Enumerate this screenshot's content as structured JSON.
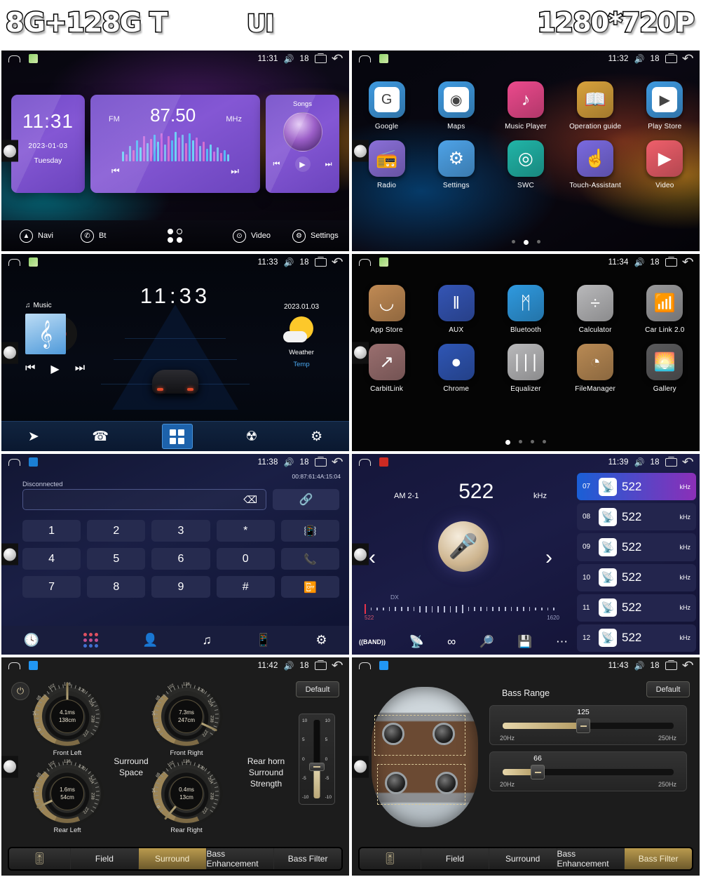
{
  "banner": {
    "left": "8G+128G T",
    "center": "UI",
    "right": "1280*720P"
  },
  "statusbar_common": {
    "volume": "18",
    "home_icon": "home-icon",
    "recents_icon": "recents-icon",
    "back_icon": "back-icon"
  },
  "panels": {
    "home_widgets": {
      "time": "11:31",
      "clock_widget": {
        "time": "11:31",
        "date": "2023-01-03",
        "weekday": "Tuesday"
      },
      "radio_widget": {
        "band": "FM",
        "frequency": "87.50",
        "unit": "MHz",
        "prev": "prev-icon",
        "next": "next-icon"
      },
      "song_widget": {
        "title": "Songs",
        "prev": "prev-icon",
        "play": "play-icon",
        "next": "next-icon"
      },
      "dock": [
        {
          "label": "Navi",
          "icon": "navi-icon"
        },
        {
          "label": "Bt",
          "icon": "bluetooth-phone-icon"
        },
        {
          "label": "",
          "icon": "apps-grid-icon"
        },
        {
          "label": "Video",
          "icon": "video-icon"
        },
        {
          "label": "Settings",
          "icon": "gear-icon"
        }
      ]
    },
    "app_drawer_1": {
      "time": "11:32",
      "rows": [
        [
          {
            "name": "Google",
            "icon": "google-icon",
            "glyph": "G",
            "bg": "#3f9ae0",
            "inner": "#ffffff"
          },
          {
            "name": "Maps",
            "icon": "maps-icon",
            "glyph": "◉",
            "bg": "#3f9ae0",
            "inner": "#ffffff"
          },
          {
            "name": "Music Player",
            "icon": "music-note-icon",
            "glyph": "♪",
            "bg": "#ec4a8d",
            "inner": ""
          },
          {
            "name": "Operation guide",
            "icon": "book-icon",
            "glyph": "📖",
            "bg": "#d8a23c",
            "inner": ""
          },
          {
            "name": "Play Store",
            "icon": "play-store-icon",
            "glyph": "▶",
            "bg": "#3f9ae0",
            "inner": "#ffffff"
          }
        ],
        [
          {
            "name": "Radio",
            "icon": "radio-icon",
            "glyph": "📻",
            "bg": "#8a6fd8",
            "inner": ""
          },
          {
            "name": "Settings",
            "icon": "gear-icon",
            "glyph": "⚙",
            "bg": "#4ea3e8",
            "inner": ""
          },
          {
            "name": "SWC",
            "icon": "steering-wheel-icon",
            "glyph": "◎",
            "bg": "#21b5a8",
            "inner": ""
          },
          {
            "name": "Touch-Assistant",
            "icon": "touch-hand-icon",
            "glyph": "☝",
            "bg": "#7a6ae0",
            "inner": ""
          },
          {
            "name": "Video",
            "icon": "video-icon",
            "glyph": "▶",
            "bg": "#ef5f6b",
            "inner": ""
          }
        ]
      ],
      "pager": {
        "count": 3,
        "active": 1
      }
    },
    "car_home": {
      "time": "11:33",
      "clock": "11:33",
      "date": "2023.01.03",
      "music_label": "Music",
      "music_icon": "music-note-icon",
      "weather_label": "Weather",
      "temp_label": "Temp",
      "controls": {
        "prev": "prev-icon",
        "play": "play-icon",
        "next": "next-icon"
      },
      "dock": [
        {
          "icon": "navigation-arrow-icon"
        },
        {
          "icon": "phone-icon"
        },
        {
          "icon": "apps-grid-icon"
        },
        {
          "icon": "radio-tower-icon"
        },
        {
          "icon": "gear-icon"
        }
      ]
    },
    "app_drawer_2": {
      "time": "11:34",
      "rows": [
        [
          {
            "name": "App Store",
            "icon": "app-store-icon",
            "glyph": "◡",
            "bg": "#c08a54"
          },
          {
            "name": "AUX",
            "icon": "aux-cable-icon",
            "glyph": "‖",
            "bg": "#3455b5"
          },
          {
            "name": "Bluetooth",
            "icon": "bluetooth-icon",
            "glyph": "ᛗ",
            "bg": "#2f9ae0"
          },
          {
            "name": "Calculator",
            "icon": "calculator-icon",
            "glyph": "÷",
            "bg": "#b9b9bb"
          },
          {
            "name": "Car Link 2.0",
            "icon": "car-link-icon",
            "glyph": "📶",
            "bg": "#9a9a9c"
          }
        ],
        [
          {
            "name": "CarbitLink",
            "icon": "carbit-link-icon",
            "glyph": "↗",
            "bg": "#9a6f6f"
          },
          {
            "name": "Chrome",
            "icon": "chrome-icon",
            "glyph": "●",
            "bg": "#2f56b5"
          },
          {
            "name": "Equalizer",
            "icon": "equalizer-icon",
            "glyph": "∣∣∣",
            "bg": "#b9b9bb"
          },
          {
            "name": "FileManager",
            "icon": "file-manager-icon",
            "glyph": "◔",
            "bg": "#b98a54"
          },
          {
            "name": "Gallery",
            "icon": "gallery-icon",
            "glyph": "🌅",
            "bg": "#5a5a5c"
          }
        ]
      ],
      "pager": {
        "count": 4,
        "active": 0
      }
    },
    "dialer": {
      "time": "11:38",
      "status": "Disconnected",
      "mac": "00:87:61:4A:15:04",
      "input_value": "",
      "input_placeholder": "",
      "backspace_icon": "backspace-icon",
      "link_icon": "link-icon",
      "keys": [
        "1",
        "2",
        "3",
        "*",
        "4",
        "5",
        "6",
        "0",
        "7",
        "8",
        "9",
        "#"
      ],
      "action_keys": [
        {
          "icon": "transfer-audio-icon"
        },
        {
          "icon": "call-answer-icon"
        },
        {
          "icon": "call-end-icon"
        }
      ],
      "dock": [
        {
          "icon": "clock-icon"
        },
        {
          "icon": "dialpad-icon"
        },
        {
          "icon": "contacts-icon"
        },
        {
          "icon": "music-icon"
        },
        {
          "icon": "bt-device-icon"
        },
        {
          "icon": "gear-icon"
        }
      ]
    },
    "radio": {
      "time": "11:39",
      "band": "AM 2-1",
      "frequency": "522",
      "unit": "kHz",
      "dx_label": "DX",
      "scale_min": "522",
      "scale_max": "1620",
      "prev_icon": "chevron-left-icon",
      "next_icon": "chevron-right-icon",
      "mic_icon": "microphone-icon",
      "tools": [
        {
          "icon": "band-icon",
          "label": "BAND"
        },
        {
          "icon": "antenna-icon"
        },
        {
          "icon": "stereo-icon"
        },
        {
          "icon": "scan-icon"
        },
        {
          "icon": "save-icon"
        },
        {
          "icon": "more-icon"
        }
      ],
      "presets": [
        {
          "no": "07",
          "freq": "522",
          "unit": "kHz",
          "active": true
        },
        {
          "no": "08",
          "freq": "522",
          "unit": "kHz",
          "active": false
        },
        {
          "no": "09",
          "freq": "522",
          "unit": "kHz",
          "active": false
        },
        {
          "no": "10",
          "freq": "522",
          "unit": "kHz",
          "active": false
        },
        {
          "no": "11",
          "freq": "522",
          "unit": "kHz",
          "active": false
        },
        {
          "no": "12",
          "freq": "522",
          "unit": "kHz",
          "active": false
        }
      ]
    },
    "audio_surround": {
      "time": "11:42",
      "default_label": "Default",
      "power_icon": "power-icon",
      "center_label": "Surround\nSpace",
      "center_label_l1": "Surround",
      "center_label_l2": "Space",
      "right_label_l1": "Rear horn",
      "right_label_l2": "Surround",
      "right_label_l3": "Strength",
      "knob_ticks": [
        "0",
        "34",
        "68",
        "102",
        "136",
        "170",
        "204",
        "238",
        "272"
      ],
      "knobs": [
        {
          "label": "Front Left",
          "ms": "4.1ms",
          "cm": "138cm",
          "angle": 0
        },
        {
          "label": "Front Right",
          "ms": "7.3ms",
          "cm": "247cm",
          "angle": 115
        },
        {
          "label": "Rear Left",
          "ms": "1.6ms",
          "cm": "54cm",
          "angle": -115
        },
        {
          "label": "Rear Right",
          "ms": "0.4ms",
          "cm": "13cm",
          "angle": -140
        }
      ],
      "fader_scale": [
        "10",
        "5",
        "0",
        "-5",
        "-10"
      ],
      "tabs": [
        {
          "label": "",
          "icon": "equalizer-sliders-icon",
          "active": false
        },
        {
          "label": "Field",
          "active": false
        },
        {
          "label": "Surround",
          "active": true
        },
        {
          "label": "Bass Enhancement",
          "active": false
        },
        {
          "label": "Bass Filter",
          "active": false
        }
      ]
    },
    "audio_bass_filter": {
      "time": "11:43",
      "default_label": "Default",
      "title": "Bass Range",
      "sliders": [
        {
          "value": "125",
          "min": "20Hz",
          "max": "250Hz",
          "pct": 46
        },
        {
          "value": "66",
          "min": "20Hz",
          "max": "250Hz",
          "pct": 20
        }
      ],
      "tabs": [
        {
          "label": "",
          "icon": "equalizer-sliders-icon",
          "active": false
        },
        {
          "label": "Field",
          "active": false
        },
        {
          "label": "Surround",
          "active": false
        },
        {
          "label": "Bass Enhancement",
          "active": false
        },
        {
          "label": "Bass Filter",
          "active": true
        }
      ]
    }
  }
}
